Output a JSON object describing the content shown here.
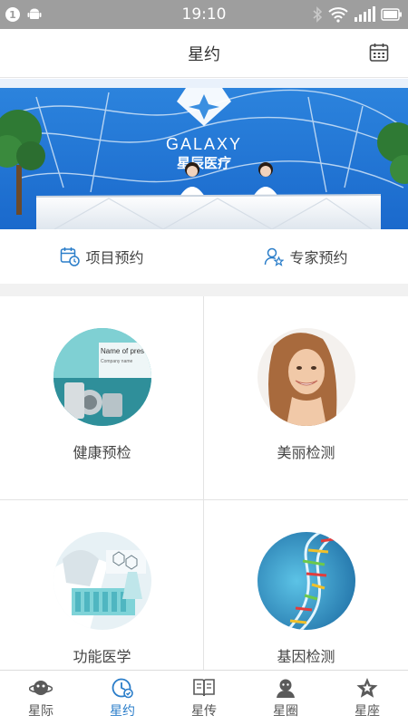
{
  "status_bar": {
    "notification_count": "1",
    "time": "19:10"
  },
  "header": {
    "title": "星约",
    "calendar_icon": "calendar-icon"
  },
  "banner": {
    "brand_en": "GALAXY",
    "brand_cn": "星辰医疗"
  },
  "booking": [
    {
      "label": "项目预约",
      "icon": "calendar-clock-icon"
    },
    {
      "label": "专家预约",
      "icon": "person-star-icon"
    }
  ],
  "services": [
    {
      "label": "健康预检",
      "thumb_text_1": "Name of pres",
      "thumb_text_2": "Company name"
    },
    {
      "label": "美丽检测"
    },
    {
      "label": "功能医学"
    },
    {
      "label": "基因检测"
    }
  ],
  "tabs": [
    {
      "label": "星际",
      "icon": "planet-icon",
      "active": false
    },
    {
      "label": "星约",
      "icon": "clock-check-icon",
      "active": true
    },
    {
      "label": "星传",
      "icon": "book-icon",
      "active": false
    },
    {
      "label": "星圈",
      "icon": "people-icon",
      "active": false
    },
    {
      "label": "星座",
      "icon": "star-icon",
      "active": false
    }
  ],
  "colors": {
    "accent": "#2a7dc9",
    "status_bar": "#9e9e9e",
    "banner_blue": "#1c6fd1"
  }
}
